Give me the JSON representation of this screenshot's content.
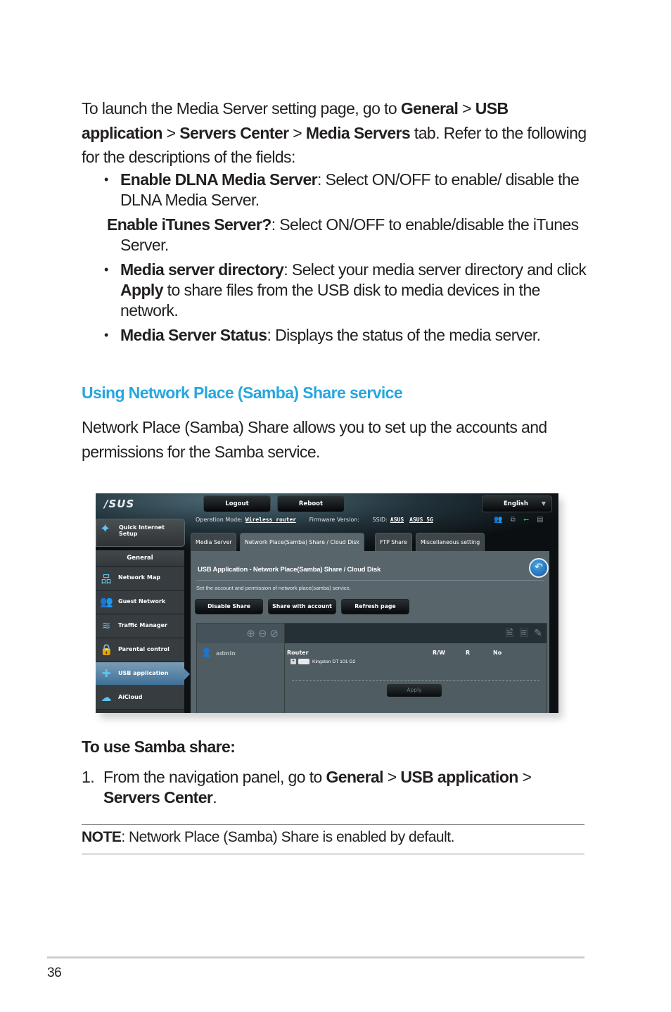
{
  "intro": {
    "t1": "To launch the Media Server setting page, go to ",
    "b1": "General",
    "t2": " > ",
    "b2": "USB application",
    "t3": " > ",
    "b3": "Servers Center",
    "t4": " > ",
    "b4": "Media Servers",
    "t5": " tab. Refer to the following for the descriptions of the fields:"
  },
  "bullets": [
    {
      "bold": "Enable DLNA Media Server",
      "text": ": Select ON/OFF to enable/ disable the DLNA Media Server."
    },
    {
      "bold": "Enable iTunes Server?",
      "text": ": Select ON/OFF to enable/disable the iTunes Server."
    },
    {
      "bold": "Media server directory",
      "text": ": Select your media server directory and click ",
      "bold2": "Apply",
      "text2": " to share files from the USB disk to media devices in the network."
    },
    {
      "bold": "Media Server Status",
      "text": ": Displays the status of the media server."
    }
  ],
  "bullet_glyph": "•",
  "samba_heading": "Using Network Place (Samba) Share service",
  "samba_desc": "Network Place (Samba) Share allows you to set up the accounts and permissions for the Samba service.",
  "router_ui": {
    "logo": "/SUS",
    "logout": "Logout",
    "reboot": "Reboot",
    "language": "English",
    "op_mode_label": "Operation Mode:",
    "op_mode_value": "Wireless router",
    "firmware_label": "Firmware Version:",
    "ssid_label": "SSID:",
    "ssid_values": [
      "ASUS",
      "ASUS_5G"
    ],
    "status_colors": {
      "active": "#22d34a",
      "inactive": "#8a9296"
    },
    "quick_setup": "Quick Internet Setup",
    "sidebar_header": "General",
    "sidebar_items": [
      {
        "label": "Network Map",
        "icon": "network-map-icon",
        "glyph": "品"
      },
      {
        "label": "Guest Network",
        "icon": "guest-network-icon",
        "glyph": "👥"
      },
      {
        "label": "Traffic Manager",
        "icon": "traffic-manager-icon",
        "glyph": "≋"
      },
      {
        "label": "Parental control",
        "icon": "lock-icon",
        "glyph": "🔒"
      },
      {
        "label": "USB application",
        "icon": "puzzle-icon",
        "glyph": "✚",
        "active": true
      },
      {
        "label": "AiCloud",
        "icon": "cloud-icon",
        "glyph": "☁"
      }
    ],
    "tabs": [
      "Media Server",
      "Network Place(Samba) Share / Cloud Disk",
      "FTP Share",
      "Miscellaneous setting"
    ],
    "active_tab": 1,
    "panel_title": "USB Application - Network Place(Samba) Share / Cloud Disk",
    "panel_desc": "Set the account and permission of network place(samba) service.",
    "buttons": [
      "Disable Share",
      "Share with account",
      "Refresh page"
    ],
    "account": "admin",
    "folder_headers": {
      "device": "Router",
      "rw": "R/W",
      "r": "R",
      "no": "No"
    },
    "disk_name": "Kingston DT 101 G2",
    "apply": "Apply"
  },
  "use_heading": "To use Samba share:",
  "step1": {
    "num": "1.",
    "t1": "From the navigation panel, go to ",
    "b1": "General",
    "t2": " > ",
    "b2": "USB application",
    "t3": " > ",
    "b3": "Servers Center",
    "t4": "."
  },
  "note": {
    "label": "NOTE",
    "text": ":  Network Place (Samba) Share is enabled by default."
  },
  "page_number": "36",
  "colors": {
    "heading_blue": "#27a6df"
  }
}
